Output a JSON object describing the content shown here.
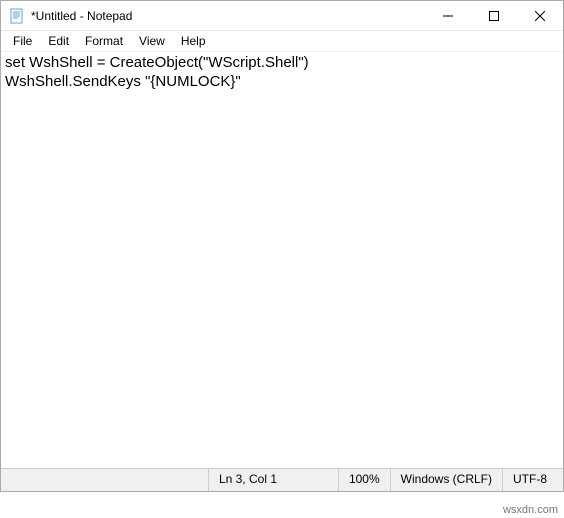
{
  "titlebar": {
    "title": "*Untitled - Notepad"
  },
  "menubar": {
    "file": "File",
    "edit": "Edit",
    "format": "Format",
    "view": "View",
    "help": "Help"
  },
  "editor": {
    "content": "set WshShell = CreateObject(\"WScript.Shell\")\nWshShell.SendKeys \"{NUMLOCK}\"\n"
  },
  "statusbar": {
    "position": "Ln 3, Col 1",
    "zoom": "100%",
    "line_ending": "Windows (CRLF)",
    "encoding": "UTF-8"
  },
  "watermark": "wsxdn.com"
}
